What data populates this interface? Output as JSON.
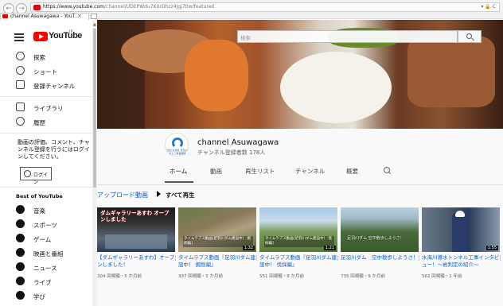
{
  "browser": {
    "url_host": "https://www.youtube.com",
    "url_path": "/channel/UDEPWdu7KXrDhzz4Jgj7tlw/featured",
    "url_right": "▾ 🔒 C",
    "tab_title": "channel Asuwagawa - YouT...",
    "tab_close": "×",
    "back": "←",
    "forward": "→"
  },
  "header": {
    "logo_text": "YouTube",
    "logo_sup": "JP",
    "search_placeholder": "検索"
  },
  "sidebar": {
    "items": [
      {
        "label": "探索",
        "icon": "compass-icon"
      },
      {
        "label": "ショート",
        "icon": "shorts-icon"
      },
      {
        "label": "登録チャンネル",
        "icon": "subscriptions-icon"
      },
      {
        "label": "ライブラリ",
        "icon": "library-icon"
      },
      {
        "label": "履歴",
        "icon": "history-icon"
      }
    ],
    "signin_text": "動画の評価、コメント、チャンネル登録を行うにはログインしてください。",
    "signin_button": "ログイン",
    "best_heading": "Best of YouTube",
    "best_items": [
      {
        "label": "音楽",
        "icon": "music-icon"
      },
      {
        "label": "スポーツ",
        "icon": "sports-icon"
      },
      {
        "label": "ゲーム",
        "icon": "gaming-icon"
      },
      {
        "label": "映画と番組",
        "icon": "movies-icon"
      },
      {
        "label": "ニュース",
        "icon": "news-icon"
      },
      {
        "label": "ライブ",
        "icon": "live-icon"
      },
      {
        "label": "学び",
        "icon": "learning-icon"
      }
    ]
  },
  "channel": {
    "name": "channel Asuwagawa",
    "subscribers": "チャンネル登録者数 178人",
    "logo_text": "国土交通省 足羽川ダム工事事務所",
    "tabs": [
      "ホーム",
      "動画",
      "再生リスト",
      "チャンネル",
      "概要"
    ]
  },
  "section": {
    "title": "アップロード動画",
    "play_all": "すべて再生"
  },
  "videos": [
    {
      "title": "【ダムギャラリーあすわ】オープンしました！",
      "meta": "304 回視聴・5 か月前",
      "duration": "",
      "thumb_text": "ダムギャラリーあすわ オープンしました"
    },
    {
      "title": "タイムラプス動画『足羽川ダム建設中！ 掘削編』",
      "meta": "337 回視聴・5 か月前",
      "duration": "1:32",
      "thumb_text": "タイムラプス動画[足羽川ダム建設中！ 掘削編]"
    },
    {
      "title": "タイムラプス動画『足羽川ダム建設中！ 伐採編』",
      "meta": "551 回視聴・8 か月前",
      "duration": "1:21",
      "thumb_text": "タイムラプス動画[足羽川ダム建設中！ 伐採編]"
    },
    {
      "title": "足羽川ダム　空中散歩しようさ！",
      "meta": "735 回視聴・9 か月前",
      "duration": "",
      "thumb_text": "足羽川ダム 空中散歩しようさ！"
    },
    {
      "title": "水海川導水トンネル工事インタビュー！～岩判定の紹介～",
      "meta": "562 回視聴・1 年前",
      "duration": "1:55",
      "thumb_text": ""
    }
  ]
}
